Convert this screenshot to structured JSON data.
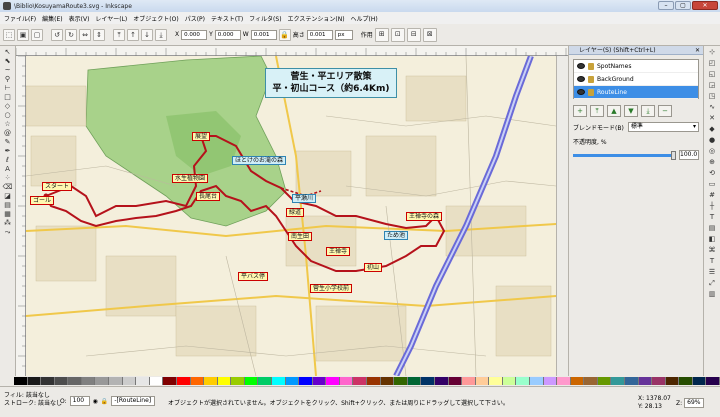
{
  "window": {
    "title": "\\Biblio\\KosuyamaRoute3.svg - Inkscape",
    "min": "–",
    "max": "▢",
    "close": "✕"
  },
  "menu": [
    "ファイル(F)",
    "編集(E)",
    "表示(V)",
    "レイヤー(L)",
    "オブジェクト(O)",
    "パス(P)",
    "テキスト(T)",
    "フィルタ(S)",
    "エクステンション(N)",
    "ヘルプ(H)"
  ],
  "toolbar": {
    "x_label": "X",
    "x_value": "0.000",
    "y_label": "Y",
    "y_value": "0.000",
    "w_label": "W",
    "w_value": "0.001",
    "h_label": "高さ",
    "h_value": "0.001",
    "unit": "px",
    "affect_label": "作用"
  },
  "map": {
    "title_line1": "菅生・平エリア散策",
    "title_line2": "平・初山コース（約6.4Km)",
    "labels": [
      {
        "text": "展望",
        "cls": "y"
      },
      {
        "text": "水生植物園",
        "cls": "y"
      },
      {
        "text": "長尾台",
        "cls": "y"
      },
      {
        "text": "ほとけのお滝の森",
        "cls": "c"
      },
      {
        "text": "平瀬川",
        "cls": "c"
      },
      {
        "text": "ため池",
        "cls": "c"
      },
      {
        "text": "緑道",
        "cls": "y"
      },
      {
        "text": "南生田",
        "cls": "y"
      },
      {
        "text": "王禅寺",
        "cls": "y"
      },
      {
        "text": "初山",
        "cls": "y"
      },
      {
        "text": "王禅寺の森",
        "cls": "y"
      },
      {
        "text": "平バス停",
        "cls": "y"
      },
      {
        "text": "菅生小学校前",
        "cls": "y"
      },
      {
        "text": "ゴール",
        "cls": "y"
      },
      {
        "text": "スタート",
        "cls": "y"
      }
    ]
  },
  "layers": {
    "header": "レイヤー(S) (Shift+Ctrl+L)",
    "close": "✕",
    "items": [
      {
        "name": "SpotNames",
        "selected": false
      },
      {
        "name": "BackGround",
        "selected": false
      },
      {
        "name": "RouteLine",
        "selected": true
      }
    ],
    "blend_label": "ブレンドモード(B)",
    "blend_value": "標準",
    "opacity_label": "不透明度, %",
    "opacity_value": "100.0",
    "opacity_fraction": 1.0
  },
  "status": {
    "fill_label": "フィル:",
    "fill_value": "該当なし",
    "stroke_label": "ストローク:",
    "stroke_value": "該当なし",
    "o_label": "O:",
    "o_value": "100",
    "layer_value": "-[RouteLine]",
    "message": "オブジェクトが選択されていません。オブジェクトをクリック、Shift+クリック、または周りにドラッグして選択して下さい。",
    "x_coord": "X: 1378.07",
    "y_coord": "Y: 28.13",
    "z_label": "Z:",
    "zoom": "69%"
  },
  "colors": {
    "accent": "#3d8ee6",
    "route": "#b5121b",
    "park": "#a8d28a",
    "road": "#6a6ad8"
  },
  "palette": [
    "#000000",
    "#1a1a1a",
    "#333333",
    "#4d4d4d",
    "#666666",
    "#808080",
    "#999999",
    "#b3b3b3",
    "#cccccc",
    "#e6e6e6",
    "#ffffff",
    "#800000",
    "#ff0000",
    "#ff6600",
    "#ffcc00",
    "#ffff00",
    "#99cc00",
    "#00ff00",
    "#00cc66",
    "#00ffff",
    "#0099ff",
    "#0000ff",
    "#6600cc",
    "#ff00ff",
    "#ff66cc",
    "#cc3366",
    "#993300",
    "#663300",
    "#336600",
    "#006633",
    "#003366",
    "#330066",
    "#660033",
    "#ff9999",
    "#ffcc99",
    "#ffff99",
    "#ccff99",
    "#99ffcc",
    "#99ccff",
    "#cc99ff",
    "#ff99cc",
    "#cc6600",
    "#996633",
    "#669900",
    "#339999",
    "#336699",
    "#663399",
    "#993366",
    "#4d2600",
    "#264d00",
    "#00264d",
    "#26004d"
  ]
}
